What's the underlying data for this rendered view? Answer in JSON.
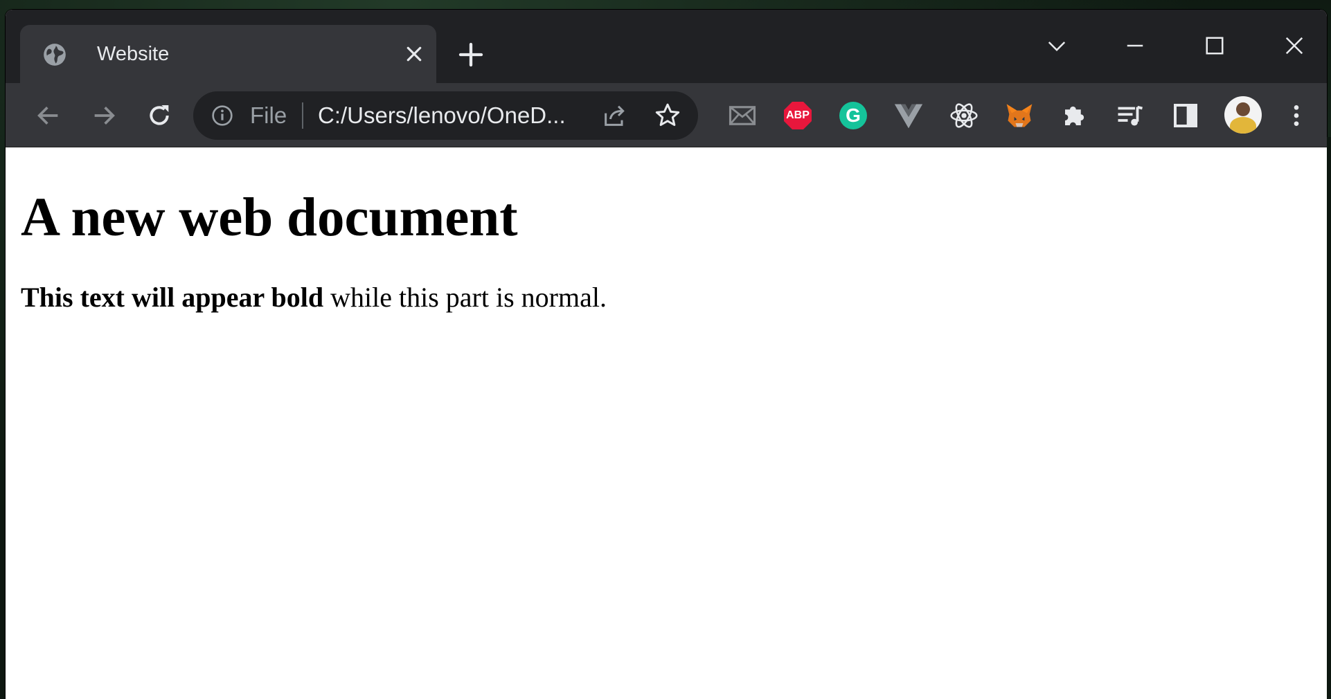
{
  "browser": {
    "tab": {
      "title": "Website"
    },
    "address_bar": {
      "scheme_label": "File",
      "url": "C:/Users/lenovo/OneD..."
    },
    "extensions": {
      "abp_label": "ABP",
      "grammarly_label": "G"
    }
  },
  "page": {
    "heading": "A new web document",
    "paragraph_bold": "This text will appear bold",
    "paragraph_normal": " while this part is normal."
  }
}
